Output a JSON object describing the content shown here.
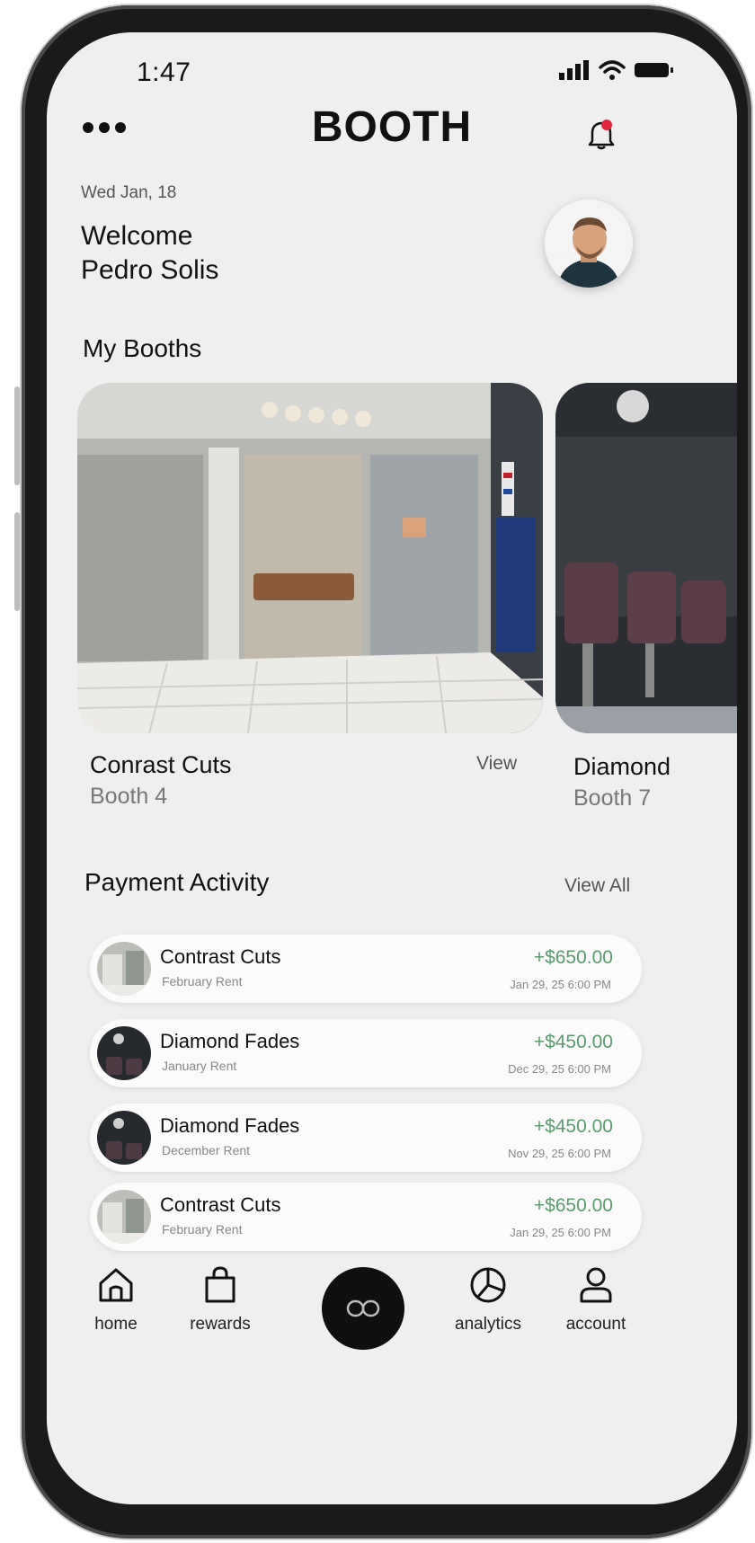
{
  "status_bar": {
    "time": "1:47"
  },
  "header": {
    "title": "BOOTH"
  },
  "welcome": {
    "date": "Wed Jan, 18",
    "greeting": "Welcome",
    "user_name": "Pedro Solis"
  },
  "booths": {
    "section_title": "My Booths",
    "items": [
      {
        "name": "Conrast Cuts",
        "booth": "Booth 4",
        "action": "View"
      },
      {
        "name": "Diamond",
        "booth": "Booth 7"
      }
    ]
  },
  "payments": {
    "section_title": "Payment Activity",
    "view_all": "View All",
    "items": [
      {
        "name": "Contrast Cuts",
        "desc": "February Rent",
        "amount": "+$650.00",
        "date": "Jan 29, 25 6:00 PM"
      },
      {
        "name": "Diamond Fades",
        "desc": "January Rent",
        "amount": "+$450.00",
        "date": "Dec 29, 25 6:00 PM"
      },
      {
        "name": "Diamond Fades",
        "desc": "December Rent",
        "amount": "+$450.00",
        "date": "Nov 29, 25 6:00 PM"
      },
      {
        "name": "Contrast Cuts",
        "desc": "February Rent",
        "amount": "+$650.00",
        "date": "Jan 29, 25 6:00 PM"
      }
    ]
  },
  "tabbar": {
    "home": "home",
    "rewards": "rewards",
    "analytics": "analytics",
    "account": "account"
  },
  "colors": {
    "amount_green": "#5a9c6e",
    "screen_bg": "#efefef",
    "notification_dot": "#e0243b"
  },
  "icons": {
    "more": "more-horizontal-icon",
    "bell": "bell-icon",
    "home": "home-icon",
    "rewards": "shopping-bag-icon",
    "center": "infinity-icon",
    "analytics": "pie-chart-icon",
    "account": "user-icon"
  }
}
